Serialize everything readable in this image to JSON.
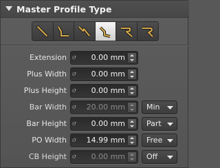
{
  "panel": {
    "title": "Master Profile Type",
    "collapse_icon": "triangle-down-icon"
  },
  "toolbar": {
    "tools": [
      {
        "icon": "profile-straight-icon",
        "active": false
      },
      {
        "icon": "profile-step-icon",
        "active": false
      },
      {
        "icon": "profile-notch-icon",
        "active": false
      },
      {
        "icon": "profile-bevel-icon",
        "active": true
      },
      {
        "icon": "profile-hook-icon",
        "active": false
      },
      {
        "icon": "profile-curl-icon",
        "active": false
      }
    ]
  },
  "fields": [
    {
      "label": "Extension",
      "value": "0.00 mm",
      "enabled": true
    },
    {
      "label": "Plus Width",
      "value": "0.00 mm",
      "enabled": true
    },
    {
      "label": "Plus Height",
      "value": "0.00 mm",
      "enabled": true
    },
    {
      "label": "Bar Width",
      "value": "20.00 mm",
      "enabled": false,
      "option": "Min"
    },
    {
      "label": "Bar Height",
      "value": "0.00 mm",
      "enabled": true,
      "option": "Part"
    },
    {
      "label": "PO Width",
      "value": "14.99 mm",
      "enabled": true,
      "option": "Free"
    },
    {
      "label": "CB Height",
      "value": "0.00 mm",
      "enabled": false,
      "option": "Off"
    }
  ],
  "colors": {
    "panel_bg": "#585858",
    "header_bg": "#4b4b4b",
    "icon_stroke": "#c9a24a",
    "field_bg": "#303030"
  }
}
